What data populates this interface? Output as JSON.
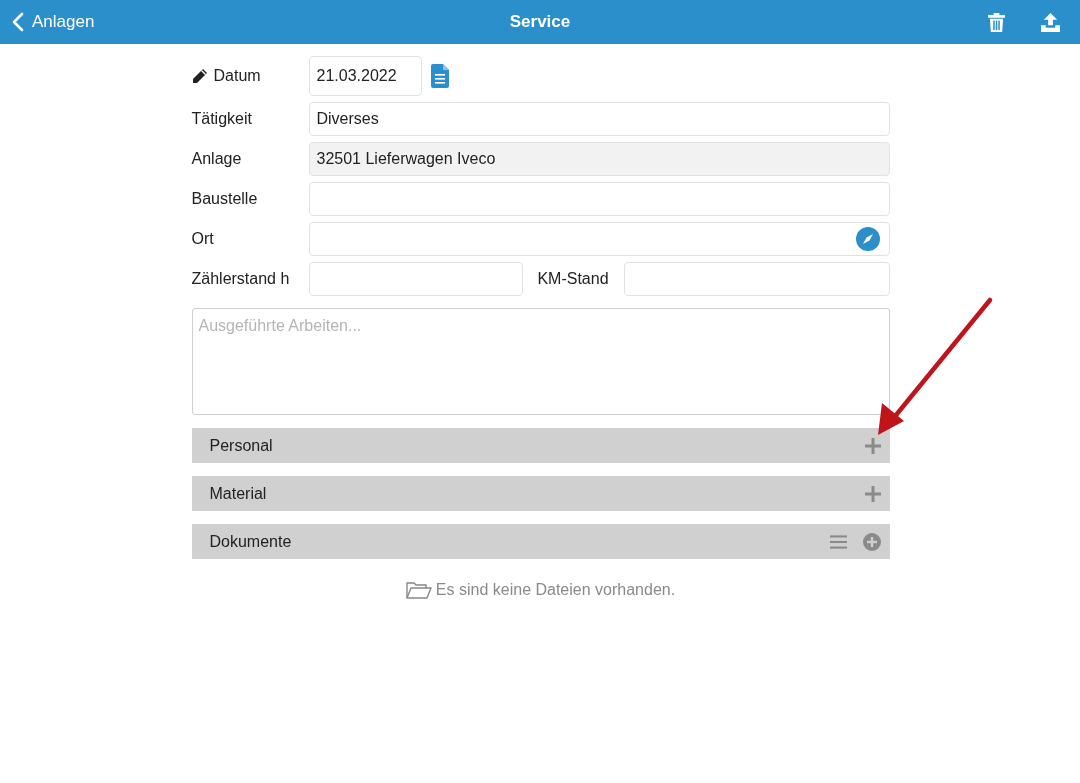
{
  "nav": {
    "back": "Anlagen",
    "title": "Service"
  },
  "fields": [
    {
      "kind": "date",
      "label": "Datum",
      "value": "21.03.2022"
    },
    {
      "kind": "text",
      "label": "Tätigkeit",
      "value": "Diverses"
    },
    {
      "kind": "readonly",
      "label": "Anlage",
      "value": "32501 Lieferwagen Iveco"
    },
    {
      "kind": "text",
      "label": "Baustelle"
    },
    {
      "kind": "location",
      "label": "Ort"
    },
    {
      "kind": "pair",
      "label": "Zählerstand h",
      "label_2": "KM-Stand"
    }
  ],
  "notes": {
    "placeholder": "Ausgeführte Arbeiten..."
  },
  "sections": [
    {
      "kind": "add",
      "title": "Personal"
    },
    {
      "kind": "add",
      "title": "Material"
    },
    {
      "kind": "docs",
      "title": "Dokumente"
    }
  ],
  "empty_message": "Es sind keine Dateien vorhanden.",
  "annotation": {
    "kind": "arrow"
  }
}
